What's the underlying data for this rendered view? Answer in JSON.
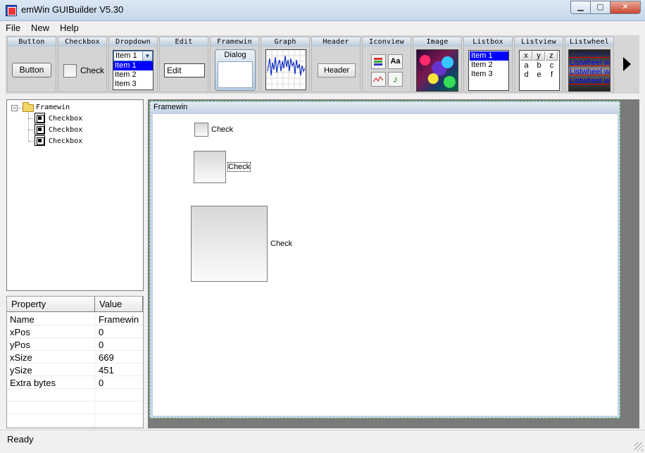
{
  "window": {
    "title": "emWin GUIBuilder V5.30"
  },
  "menu": [
    {
      "label": "File"
    },
    {
      "label": "New"
    },
    {
      "label": "Help"
    }
  ],
  "toolbar": {
    "widgets": {
      "button": {
        "label": "Button",
        "sample": "Button"
      },
      "checkbox": {
        "label": "Checkbox",
        "sample": "Check"
      },
      "dropdown": {
        "label": "Dropdown",
        "selected": "Item 1",
        "items": [
          "Item 1",
          "Item 2",
          "Item 3"
        ]
      },
      "edit": {
        "label": "Edit",
        "sample": "Edit"
      },
      "framewin": {
        "label": "Framewin",
        "sample": "Dialog"
      },
      "graph": {
        "label": "Graph"
      },
      "header": {
        "label": "Header",
        "sample": "Header"
      },
      "iconview": {
        "label": "Iconview",
        "icons": [
          "books-icon",
          "font-icon",
          "graph-icon",
          "music-note-icon"
        ],
        "font_icon_text": "Aa",
        "note_icon_text": "♪"
      },
      "image": {
        "label": "Image"
      },
      "listbox": {
        "label": "Listbox",
        "items": [
          "Item 1",
          "Item 2",
          "Item 3"
        ]
      },
      "listview": {
        "label": "Listview",
        "headers": [
          "x",
          "y",
          "z"
        ],
        "rows": [
          [
            "a",
            "b",
            "c"
          ],
          [
            "d",
            "e",
            "f"
          ]
        ]
      },
      "listwheel": {
        "label": "Listwheel",
        "items": [
          "Listwheel wid",
          "Listwheel wid",
          "Listwheel wid",
          "Listwheel wid"
        ]
      }
    }
  },
  "tree": {
    "root": {
      "label": "Framewin",
      "expander": "−"
    },
    "children": [
      {
        "label": "Checkbox"
      },
      {
        "label": "Checkbox"
      },
      {
        "label": "Checkbox"
      }
    ]
  },
  "properties": {
    "headers": {
      "property": "Property",
      "value": "Value"
    },
    "rows": [
      {
        "name": "Name",
        "value": "Framewin"
      },
      {
        "name": "xPos",
        "value": "0"
      },
      {
        "name": "yPos",
        "value": "0"
      },
      {
        "name": "xSize",
        "value": "669"
      },
      {
        "name": "ySize",
        "value": "451"
      },
      {
        "name": "Extra bytes",
        "value": "0"
      }
    ]
  },
  "design": {
    "frame_title": "Framewin",
    "checkboxes": [
      {
        "label": "Check"
      },
      {
        "label": "Check"
      },
      {
        "label": "Check"
      }
    ]
  },
  "status": {
    "text": "Ready"
  }
}
